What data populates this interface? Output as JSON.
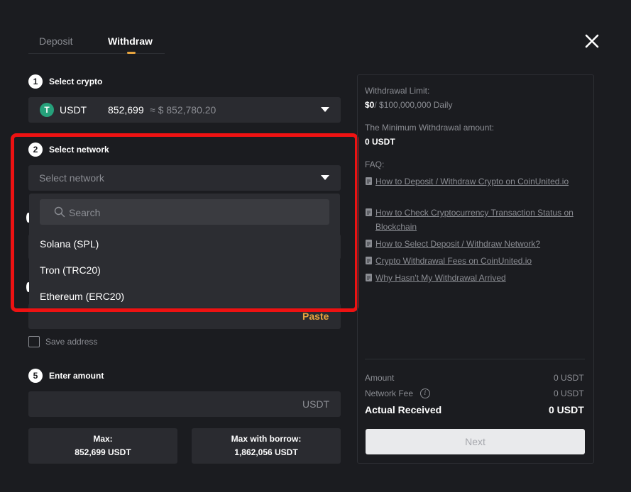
{
  "tabs": {
    "deposit": "Deposit",
    "withdraw": "Withdraw"
  },
  "steps": {
    "crypto": {
      "num": "1",
      "label": "Select crypto"
    },
    "network": {
      "num": "2",
      "label": "Select network"
    },
    "amount": {
      "num": "5",
      "label": "Enter amount"
    }
  },
  "crypto": {
    "icon": "tether-icon",
    "icon_glyph": "T",
    "name": "USDT",
    "balance": "852,699",
    "approx": "≈ $ 852,780.20"
  },
  "network": {
    "placeholder": "Select network",
    "search_placeholder": "Search",
    "options": [
      "Solana (SPL)",
      "Tron (TRC20)",
      "Ethereum (ERC20)"
    ]
  },
  "address": {
    "paste_label": "Paste",
    "save_label": "Save address"
  },
  "amount": {
    "unit": "USDT",
    "max_label": "Max:",
    "max_value": "852,699 USDT",
    "borrow_label": "Max with borrow:",
    "borrow_value": "1,862,056 USDT"
  },
  "panel": {
    "limit_label": "Withdrawal Limit:",
    "limit_used": "$0",
    "limit_total": "/ $100,000,000 Daily",
    "min_label": "The Minimum Withdrawal amount:",
    "min_value": "0 USDT",
    "faq_label": "FAQ:",
    "faq": [
      "How to Deposit / Withdraw Crypto on CoinUnited.io",
      "How to Check Cryptocurrency Transaction Status on Blockchain",
      "How to Select Deposit / Withdraw Network?",
      "Crypto Withdrawal Fees on CoinUnited.io",
      "Why Hasn't My Withdrawal Arrived"
    ],
    "amount_label": "Amount",
    "amount_value": "0 USDT",
    "fee_label": "Network Fee",
    "fee_value": "0 USDT",
    "received_label": "Actual Received",
    "received_value": "0 USDT",
    "next_label": "Next"
  },
  "colors": {
    "background": "#1b1c20",
    "field": "#2a2b30",
    "accent": "#e6a33e",
    "highlight": "#ee1212",
    "tether": "#26a17b"
  }
}
